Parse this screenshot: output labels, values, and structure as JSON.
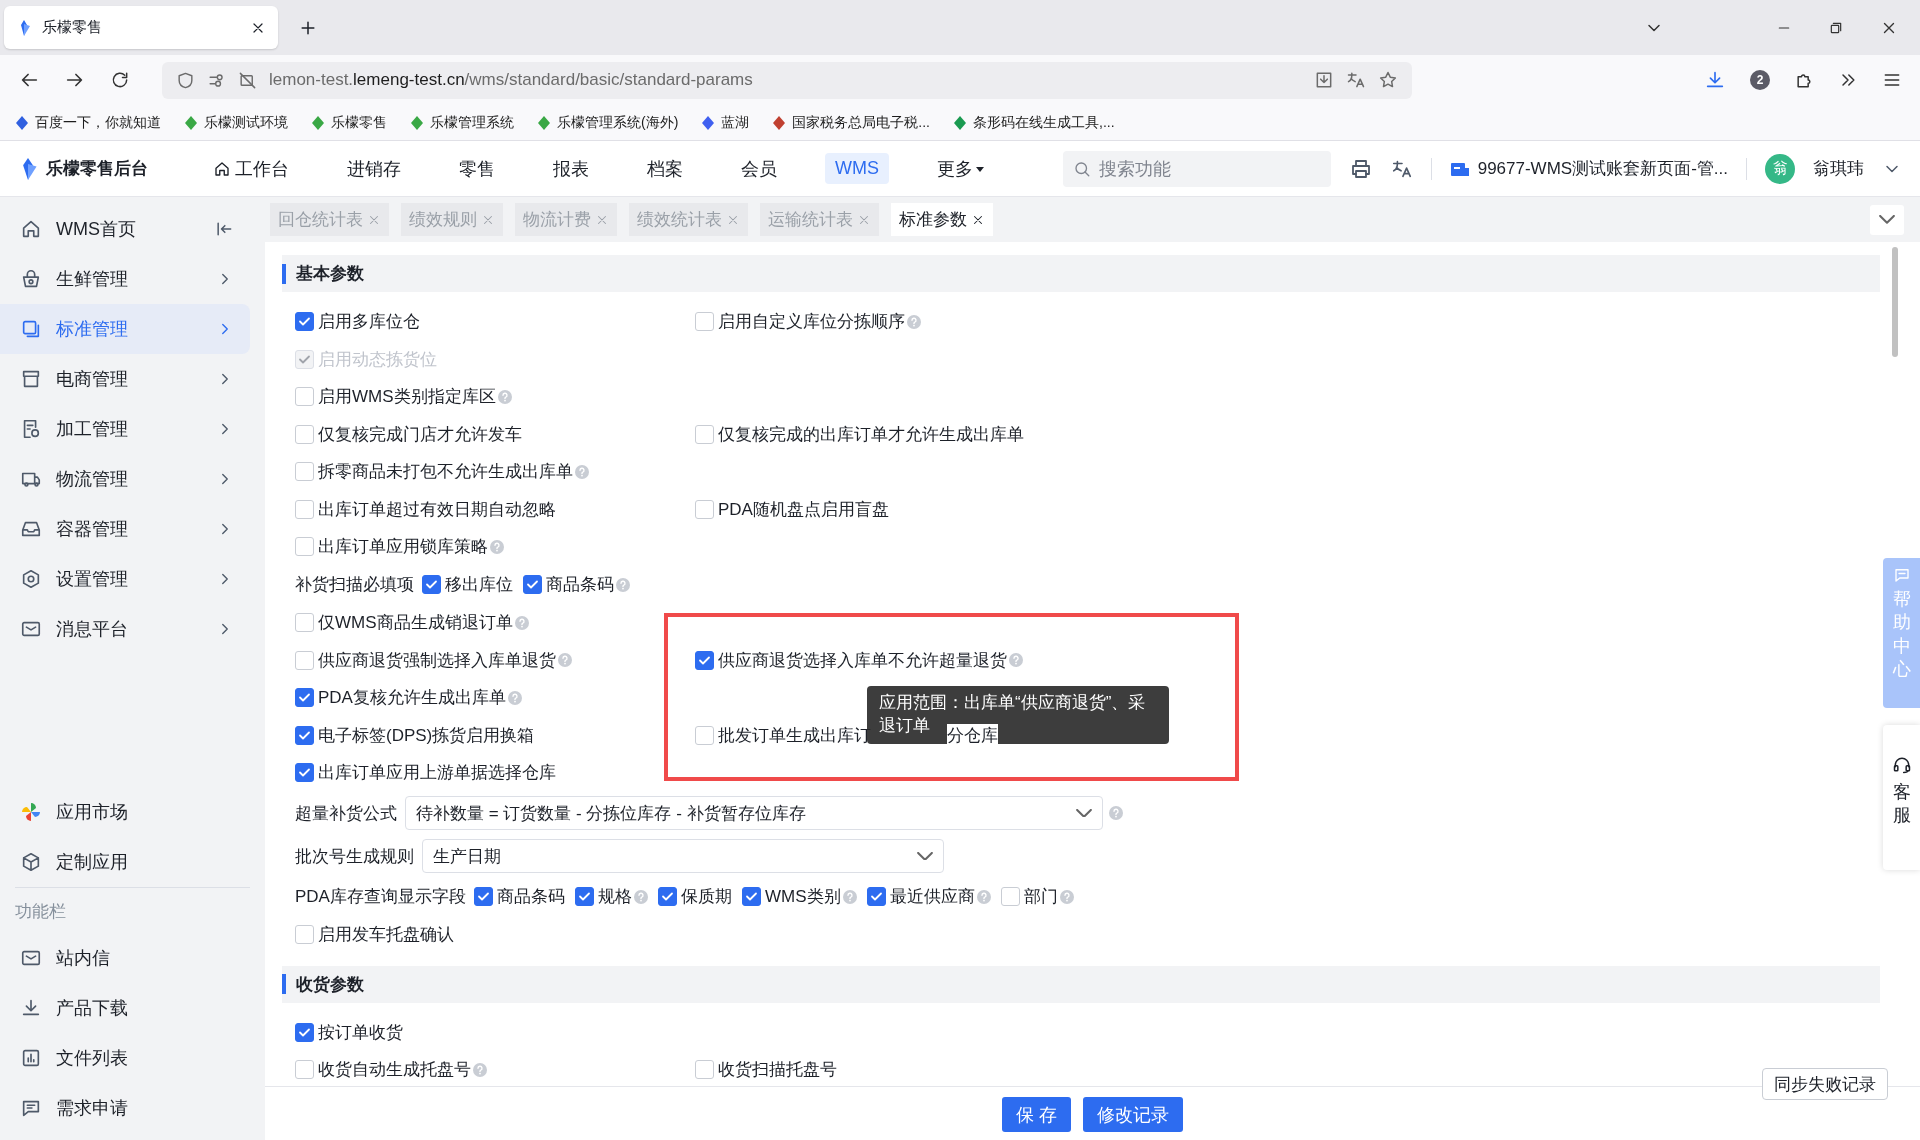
{
  "browser": {
    "tab_title": "乐檬零售",
    "url_prefix": "lemon-test.",
    "url_domain": "lemeng-test.cn",
    "url_path": "/wms/standard/basic/standard-params",
    "badge": "2",
    "bookmarks": [
      "百度一下，你就知道",
      "乐檬测试环境",
      "乐檬零售",
      "乐檬管理系统",
      "乐檬管理系统(海外)",
      "蓝湖",
      "国家税务总局电子税...",
      "条形码在线生成工具,..."
    ]
  },
  "header": {
    "logo": "乐檬零售后台",
    "nav": [
      {
        "label": "工作台",
        "selected": false
      },
      {
        "label": "进销存",
        "selected": false
      },
      {
        "label": "零售",
        "selected": false
      },
      {
        "label": "报表",
        "selected": false
      },
      {
        "label": "档案",
        "selected": false
      },
      {
        "label": "会员",
        "selected": false
      },
      {
        "label": "WMS",
        "selected": true
      }
    ],
    "more": "更多",
    "search_placeholder": "搜索功能",
    "account": "99677-WMS测试账套新页面-管...",
    "avatar": "翁",
    "user": "翁琪玮"
  },
  "sidebar": {
    "items": [
      {
        "label": "WMS首页",
        "selected": false
      },
      {
        "label": "生鲜管理",
        "selected": false
      },
      {
        "label": "标准管理",
        "selected": true
      },
      {
        "label": "电商管理",
        "selected": false
      },
      {
        "label": "加工管理",
        "selected": false
      },
      {
        "label": "物流管理",
        "selected": false
      },
      {
        "label": "容器管理",
        "selected": false
      },
      {
        "label": "设置管理",
        "selected": false
      },
      {
        "label": "消息平台",
        "selected": false
      }
    ],
    "apps": [
      "应用市场",
      "定制应用"
    ],
    "tools_label": "功能栏",
    "tools": [
      "站内信",
      "产品下载",
      "文件列表",
      "需求申请"
    ]
  },
  "tabs": [
    {
      "label": "回仓统计表",
      "selected": false
    },
    {
      "label": "绩效规则",
      "selected": false
    },
    {
      "label": "物流计费",
      "selected": false
    },
    {
      "label": "绩效统计表",
      "selected": false
    },
    {
      "label": "运输统计表",
      "selected": false
    },
    {
      "label": "标准参数",
      "selected": true
    }
  ],
  "sections": [
    {
      "title": "基本参数",
      "rows": [
        {
          "kind": "checks",
          "highlighted": false,
          "left": {
            "label": "启用多库位仓",
            "checked": true,
            "disabled": false,
            "help": false
          },
          "right": {
            "label": "启用自定义库位分拣顺序",
            "checked": false,
            "disabled": false,
            "help": true
          }
        },
        {
          "kind": "checks",
          "highlighted": false,
          "left": {
            "label": "启用动态拣货位",
            "checked": true,
            "disabled": true,
            "help": false
          }
        },
        {
          "kind": "checks",
          "highlighted": false,
          "left": {
            "label": "启用WMS类别指定库区",
            "checked": false,
            "disabled": false,
            "help": true
          }
        },
        {
          "kind": "checks",
          "highlighted": false,
          "left": {
            "label": "仅复核完成门店才允许发车",
            "checked": false,
            "disabled": false,
            "help": false
          },
          "right": {
            "label": "仅复核完成的出库订单才允许生成出库单",
            "checked": false,
            "disabled": false,
            "help": false
          }
        },
        {
          "kind": "checks",
          "highlighted": false,
          "left": {
            "label": "拆零商品未打包不允许生成出库单",
            "checked": false,
            "disabled": false,
            "help": true
          }
        },
        {
          "kind": "checks",
          "highlighted": false,
          "left": {
            "label": "出库订单超过有效日期自动忽略",
            "checked": false,
            "disabled": false,
            "help": false
          },
          "right": {
            "label": "PDA随机盘点启用盲盘",
            "checked": false,
            "disabled": false,
            "help": false
          }
        },
        {
          "kind": "checks",
          "highlighted": false,
          "left": {
            "label": "出库订单应用锁库策略",
            "checked": false,
            "disabled": false,
            "help": true
          }
        },
        {
          "kind": "options",
          "highlighted": false,
          "label": "补货扫描必填项",
          "items": [
            {
              "label": "移出库位",
              "checked": true,
              "disabled": false,
              "help": false
            },
            {
              "label": "商品条码",
              "checked": true,
              "disabled": false,
              "help": true
            }
          ]
        },
        {
          "kind": "checks",
          "highlighted": false,
          "left": {
            "label": "仅WMS商品生成销退订单",
            "checked": false,
            "disabled": false,
            "help": true
          }
        },
        {
          "kind": "checks",
          "highlighted": true,
          "left": {
            "label": "供应商退货强制选择入库单退货",
            "checked": false,
            "disabled": false,
            "help": true
          },
          "right": {
            "label": "供应商退货选择入库单不允许超量退货",
            "checked": true,
            "disabled": false,
            "help": true,
            "tooltip": "应用范围：出库单“供应商退货”、采退订单"
          }
        },
        {
          "kind": "checks",
          "highlighted": true,
          "left": {
            "label": "PDA复核允许生成出库单",
            "checked": true,
            "disabled": false,
            "help": true
          }
        },
        {
          "kind": "checks",
          "highlighted": true,
          "left": {
            "label": "电子标签(DPS)拣货启用换箱",
            "checked": true,
            "disabled": false,
            "help": false
          },
          "right": {
            "label": "批发订单生成出库订",
            "label_after_tooltip": "分仓库",
            "checked": false,
            "disabled": false,
            "help": false
          }
        },
        {
          "kind": "checks",
          "highlighted": false,
          "left": {
            "label": "出库订单应用上游单据选择仓库",
            "checked": true,
            "disabled": false,
            "help": false
          }
        },
        {
          "kind": "select",
          "highlighted": false,
          "label": "超量补货公式",
          "value": "待补数量 = 订货数量 - 分拣位库存 - 补货暂存位库存",
          "help": true
        },
        {
          "kind": "select",
          "highlighted": false,
          "label": "批次号生成规则",
          "value": "生产日期",
          "help": false
        },
        {
          "kind": "options",
          "highlighted": false,
          "label": "PDA库存查询显示字段",
          "items": [
            {
              "label": "商品条码",
              "checked": true,
              "disabled": false,
              "help": false
            },
            {
              "label": "规格",
              "checked": true,
              "disabled": false,
              "help": true
            },
            {
              "label": "保质期",
              "checked": true,
              "disabled": false,
              "help": false
            },
            {
              "label": "WMS类别",
              "checked": true,
              "disabled": false,
              "help": true
            },
            {
              "label": "最近供应商",
              "checked": true,
              "disabled": false,
              "help": true
            },
            {
              "label": "部门",
              "checked": false,
              "disabled": false,
              "help": true
            }
          ]
        },
        {
          "kind": "checks",
          "highlighted": false,
          "left": {
            "label": "启用发车托盘确认",
            "checked": false,
            "disabled": false,
            "help": false
          }
        }
      ]
    },
    {
      "title": "收货参数",
      "rows": [
        {
          "kind": "checks",
          "highlighted": false,
          "left": {
            "label": "按订单收货",
            "checked": true,
            "disabled": false,
            "help": false
          }
        },
        {
          "kind": "checks",
          "highlighted": false,
          "left": {
            "label": "收货自动生成托盘号",
            "checked": false,
            "disabled": false,
            "help": true
          },
          "right": {
            "label": "收货扫描托盘号",
            "checked": false,
            "disabled": false,
            "help": false
          }
        }
      ]
    }
  ],
  "actions": [
    "保 存",
    "修改记录"
  ],
  "sync_button": "同步失败记录",
  "help_tab": "帮助中心",
  "service_tab": "客服"
}
